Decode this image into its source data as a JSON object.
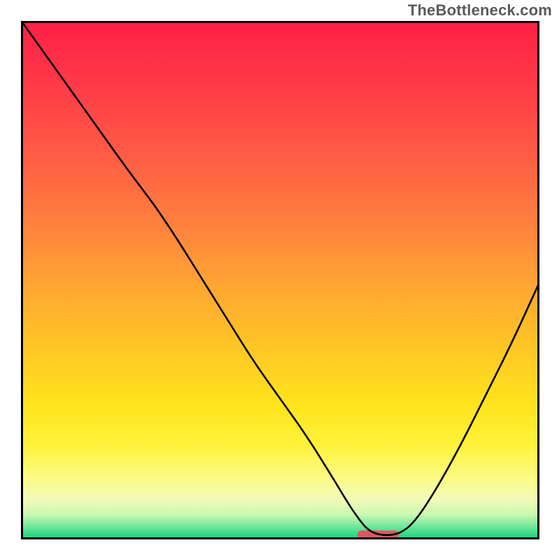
{
  "brand": {
    "label": "TheBottleneck.com"
  },
  "colors": {
    "curve": "#000000",
    "marker": "#d85a63",
    "frame": "#000000",
    "gradient_stops": [
      {
        "offset": 0.0,
        "color": "#ff1f46"
      },
      {
        "offset": 0.12,
        "color": "#ff3a47"
      },
      {
        "offset": 0.25,
        "color": "#ff5a45"
      },
      {
        "offset": 0.38,
        "color": "#ff7d3f"
      },
      {
        "offset": 0.5,
        "color": "#ffa233"
      },
      {
        "offset": 0.62,
        "color": "#ffc326"
      },
      {
        "offset": 0.74,
        "color": "#ffe31c"
      },
      {
        "offset": 0.82,
        "color": "#fff23a"
      },
      {
        "offset": 0.88,
        "color": "#fcfb80"
      },
      {
        "offset": 0.925,
        "color": "#f2fbb8"
      },
      {
        "offset": 0.955,
        "color": "#c9f7b0"
      },
      {
        "offset": 0.978,
        "color": "#6fe69a"
      },
      {
        "offset": 1.0,
        "color": "#16d67f"
      }
    ]
  },
  "chart_data": {
    "type": "line",
    "title": "",
    "xlabel": "",
    "ylabel": "",
    "xlim": [
      0,
      100
    ],
    "ylim": [
      0,
      100
    ],
    "x": [
      0,
      5,
      10,
      15,
      20,
      23,
      26,
      30,
      35,
      40,
      45,
      50,
      55,
      60,
      63,
      65,
      67,
      69.5,
      73,
      76,
      80,
      85,
      90,
      95,
      100
    ],
    "values": [
      100,
      93,
      86,
      79,
      72,
      68,
      64,
      58,
      50,
      42,
      34,
      27,
      20,
      12,
      7,
      4,
      1.5,
      0.5,
      0.7,
      3,
      9,
      18,
      28,
      38,
      49
    ],
    "marker": {
      "x_start": 65,
      "x_end": 73,
      "y": 0.5
    }
  }
}
